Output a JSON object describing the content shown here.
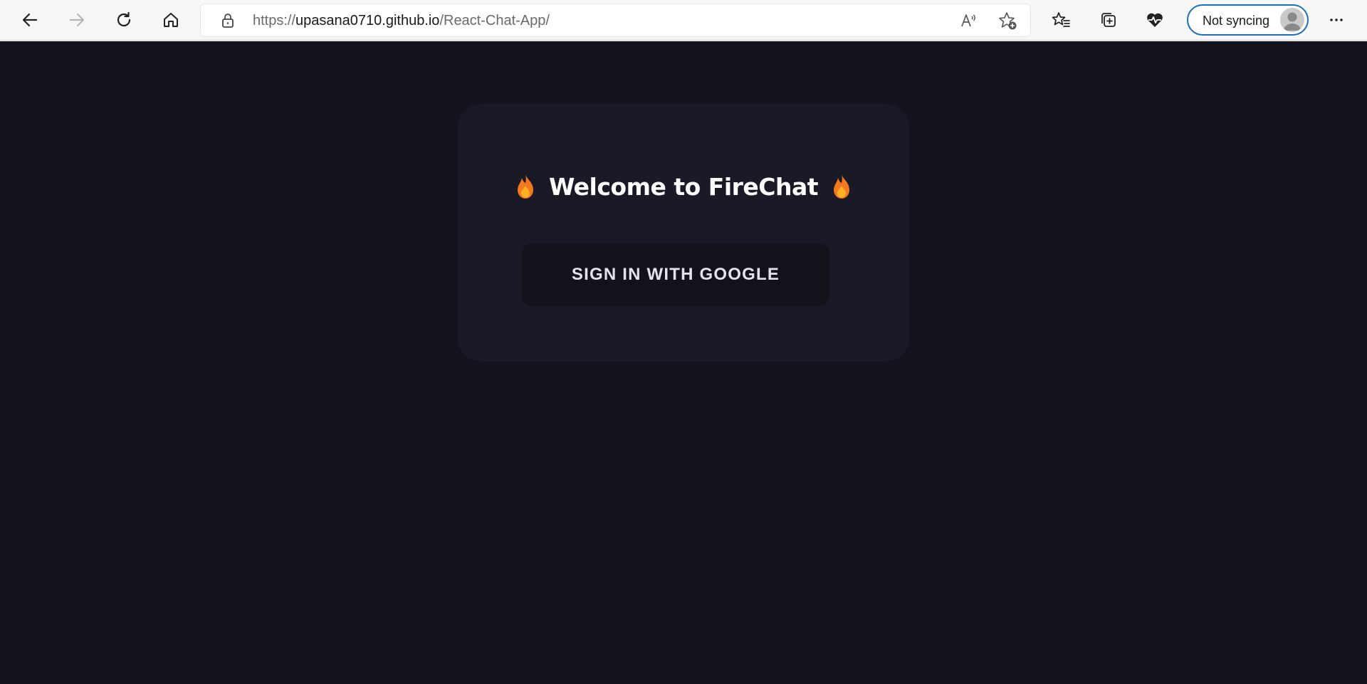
{
  "browser": {
    "url_prefix": "https://",
    "url_host": "upasana0710.github.io",
    "url_path": "/React-Chat-App/",
    "sync_label": "Not syncing",
    "accent_color": "#1b6fb5"
  },
  "toolbar_icons": [
    "back-icon",
    "forward-icon",
    "refresh-icon",
    "home-icon",
    "lock-icon",
    "read-aloud-icon",
    "add-favorite-icon",
    "favorites-icon",
    "collections-icon",
    "browser-essentials-icon",
    "profile-icon",
    "more-icon"
  ],
  "page": {
    "title": "Welcome to FireChat",
    "signin_label": "SIGN IN WITH GOOGLE",
    "background_color": "#13131d",
    "card_color": "#1a1a26",
    "flame_icon": "fire-emoji"
  }
}
